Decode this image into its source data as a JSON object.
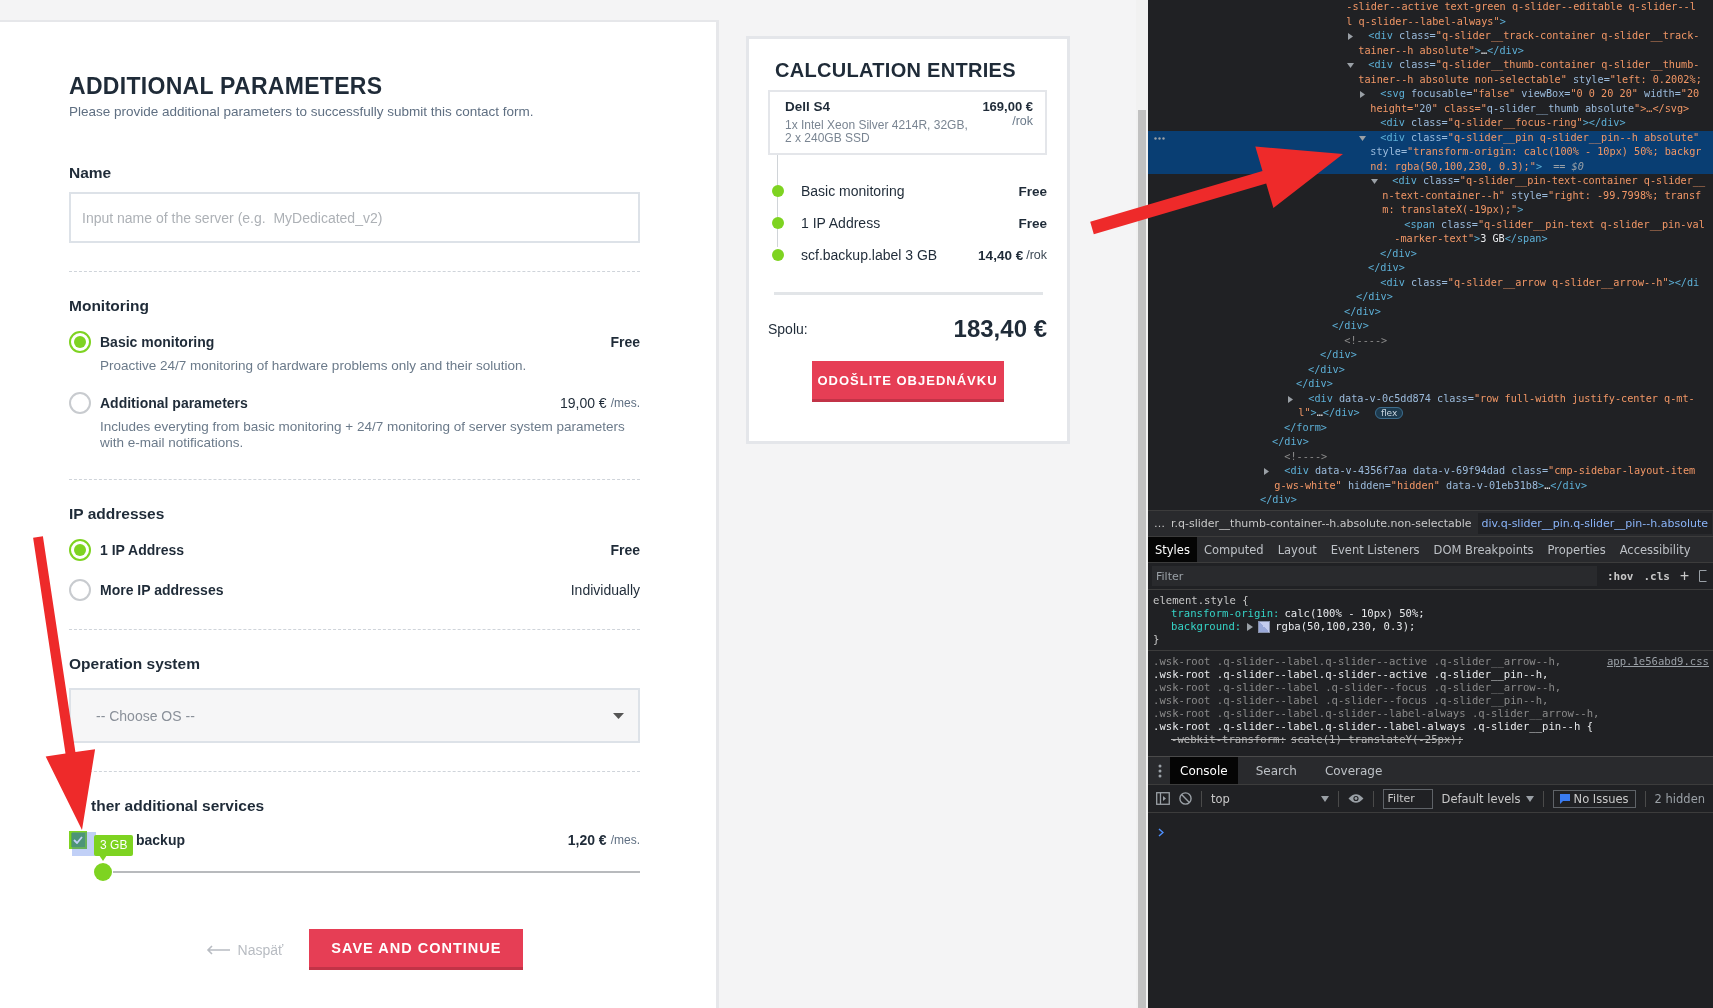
{
  "form": {
    "title": "ADDITIONAL PARAMETERS",
    "subtitle": "Please provide additional parameters to successfully submit this contact form.",
    "name_field": {
      "label": "Name",
      "placeholder": "Input name of the server (e.g.  MyDedicated_v2)"
    },
    "sections": [
      {
        "title": "Monitoring",
        "kind": "radio",
        "options": [
          {
            "label": "Basic monitoring",
            "price": "Free",
            "description": "Proactive 24/7 monitoring of hardware problems only and their solution.",
            "selected": true
          },
          {
            "label": "Additional parameters",
            "price": "19,00 €",
            "unit": "/mes.",
            "description": "Includes everyting from basic monitoring + 24/7 monitoring of server system parameters with e-mail notifications.",
            "selected": false
          }
        ]
      },
      {
        "title": "IP addresses",
        "kind": "radio",
        "options": [
          {
            "label": "1 IP Address",
            "price": "Free",
            "selected": true
          },
          {
            "label": "More IP addresses",
            "price": "Individually",
            "selected": false
          }
        ]
      },
      {
        "title": "Operation system",
        "kind": "select",
        "placeholder": "-- Choose OS --"
      },
      {
        "title": "ther additional services",
        "kind": "checkbox",
        "options": [
          {
            "label": "backup",
            "price": "1,20 €",
            "unit": "/mes.",
            "checked": true,
            "slider": {
              "level": 0.002,
              "pin": "3 GB"
            }
          }
        ]
      }
    ],
    "back_link": "Naspäť",
    "submit": "SAVE AND CONTINUE"
  },
  "calculation": {
    "title": "CALCULATION ENTRIES",
    "product": {
      "name": "Dell S4",
      "specs": "1x Intel Xeon Silver 4214R, 32GB, 2 x 240GB SSD",
      "price": "169,00 €",
      "unit": "/rok"
    },
    "entries": [
      {
        "label": "Basic monitoring",
        "price": "Free"
      },
      {
        "label": "1 IP Address",
        "price": "Free"
      },
      {
        "label": "scf.backup.label 3 GB",
        "price": "14,40 €",
        "unit": "/rok"
      }
    ],
    "total_label": "Spolu:",
    "total": "183,40 €",
    "order_button": "ODOŠLITE OBJEDNÁVKU"
  },
  "devtools": {
    "elements": {
      "nodes": [
        {
          "close": "</div>",
          "children": [
            {
              "close": "</div>",
              "children": [
                {
                  "close": "</form>",
                  "children": [
                    {
                      "close": "</div>",
                      "children": [
                        {
                          "close": "</div>",
                          "children": [
                            {
                              "close": "</div>",
                              "children": [
                                {
                                  "close": "</div>",
                                  "children": [
                                    {
                                      "continued": true,
                                      "selected": false,
                                      "lines": [
                                        "-slider--active text-green q-slider--editable q-slider--l",
                                        "l q-slider--label-always\">"
                                      ],
                                      "close": "</div>",
                                      "children": [
                                        {
                                          "expanded": false,
                                          "selected": false,
                                          "lines": [
                                            "<div class=\"q-slider__track-container q-slider__track-",
                                            "tainer--h absolute\">…</div>"
                                          ]
                                        },
                                        {
                                          "expanded": true,
                                          "selected": false,
                                          "lines": [
                                            "<div class=\"q-slider__thumb-container q-slider__thumb-",
                                            "tainer--h absolute non-selectable\" style=\"left: 0.2002%;"
                                          ],
                                          "close": "</div>",
                                          "children": [
                                            {
                                              "expanded": false,
                                              "selected": false,
                                              "lines": [
                                                "<svg focusable=\"false\" viewBox=\"0 0 20 20\" width=\"20",
                                                "height=\"20\" class=\"q-slider__thumb absolute\">…</svg>"
                                              ]
                                            },
                                            {
                                              "selected": false,
                                              "lines": [
                                                "<div class=\"q-slider__focus-ring\"></div>"
                                              ]
                                            },
                                            {
                                              "expanded": true,
                                              "selected": true,
                                              "lines": [
                                                "<div class=\"q-slider__pin q-slider__pin--h absolute\"",
                                                "style=\"transform-origin: calc(100% - 10px) 50%; backgr",
                                                "nd: rgba(50,100,230, 0.3);\">"
                                              ],
                                              "suffix": "== $0",
                                              "close": "</div>",
                                              "children": [
                                                {
                                                  "expanded": true,
                                                  "selected": false,
                                                  "lines": [
                                                    "<div class=\"q-slider__pin-text-container q-slider__",
                                                    "n-text-container--h\" style=\"right: -99.7998%; transf",
                                                    "m: translateX(-19px);\">"
                                                  ],
                                                  "close": "</div>",
                                                  "children": [
                                                    {
                                                      "selected": false,
                                                      "lines": [
                                                        "<span class=\"q-slider__pin-text q-slider__pin-val",
                                                        "-marker-text\">3 GB</span>"
                                                      ]
                                                    }
                                                  ]
                                                }
                                              ]
                                            },
                                            {
                                              "selected": false,
                                              "lines": [
                                                "<div class=\"q-slider__arrow q-slider__arrow--h\"></di"
                                              ]
                                            }
                                          ]
                                        }
                                      ]
                                    }
                                  ]
                                },
                                {
                                  "selected": false,
                                  "lines": [
                                    "<!---->"
                                  ]
                                }
                              ]
                            }
                          ]
                        }
                      ]
                    },
                    {
                      "expanded": false,
                      "selected": false,
                      "lines": [
                        "<div data-v-0c5dd874 class=\"row full-width justify-center q-mt-",
                        "l\">…</div>"
                      ],
                      "badge": "flex"
                    }
                  ]
                }
              ]
            },
            {
              "selected": false,
              "lines": [
                "<!---->"
              ]
            },
            {
              "expanded": false,
              "selected": false,
              "lines": [
                "<div data-v-4356f7aa data-v-69f94dad class=\"cmp-sidebar-layout-item",
                "g-ws-white\" hidden=\"hidden\" data-v-01eb31b8>…</div>"
              ]
            }
          ]
        }
      ]
    },
    "breadcrumbs": {
      "overflow": "…",
      "items": [
        {
          "label": "r.q-slider__thumb-container--h.absolute.non-selectable",
          "selected": false
        },
        {
          "label": "div.q-slider__pin.q-slider__pin--h.absolute",
          "selected": true
        }
      ]
    },
    "pane_tabs": [
      {
        "label": "Styles",
        "selected": true
      },
      {
        "label": "Computed",
        "selected": false
      },
      {
        "label": "Layout",
        "selected": false
      },
      {
        "label": "Event Listeners",
        "selected": false
      },
      {
        "label": "DOM Breakpoints",
        "selected": false
      },
      {
        "label": "Properties",
        "selected": false
      },
      {
        "label": "Accessibility",
        "selected": false
      }
    ],
    "filter_placeholder": "Filter",
    "hov": ":hov",
    "cls": ".cls",
    "plus": "+",
    "element_style": {
      "selector": "element.style {",
      "declarations": [
        {
          "property": "transform-origin:",
          "value": "calc(100% - 10px) 50%;"
        },
        {
          "property": "background:",
          "value": "rgba(50,100,230, 0.3);",
          "swatch": true
        }
      ],
      "close": "}"
    },
    "rule": {
      "source": "app.1e56abd9.css",
      "selectors": [
        {
          "text": ".wsk-root .q-slider--label.q-slider--active .q-slider__arrow--h,",
          "matched": false
        },
        {
          "text": ".wsk-root .q-slider--label.q-slider--active .q-slider__pin--h,",
          "matched": true
        },
        {
          "text": ".wsk-root .q-slider--label .q-slider--focus .q-slider__arrow--h,",
          "matched": false
        },
        {
          "text": ".wsk-root .q-slider--label .q-slider--focus .q-slider__pin--h,",
          "matched": false
        },
        {
          "text": ".wsk-root .q-slider--label.q-slider--label-always .q-slider__arrow--h,",
          "matched": false
        },
        {
          "text": ".wsk-root .q-slider--label.q-slider--label-always .q-slider__pin--h {",
          "matched": true
        }
      ],
      "declarations": [
        {
          "property": "-webkit-transform:",
          "value": "scale(1) translateY(-25px);",
          "overridden": true
        }
      ]
    },
    "drawer_tabs": [
      {
        "label": "Console",
        "selected": true
      },
      {
        "label": "Search",
        "selected": false
      },
      {
        "label": "Coverage",
        "selected": false
      }
    ],
    "console": {
      "context": "top",
      "filter_placeholder": "Filter",
      "levels": "Default levels",
      "issues": "No Issues",
      "hidden": "2 hidden"
    }
  }
}
